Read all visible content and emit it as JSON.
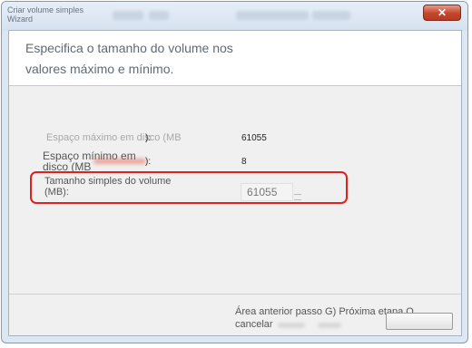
{
  "window": {
    "title": "Criar volume simples Wizard",
    "close_glyph": "✕"
  },
  "header": {
    "heading": "Especifica o tamanho do volume nos valores máximo e mínimo."
  },
  "fields": {
    "max_label": "Espaço máximo em disco (MB",
    "max_colon": "):",
    "max_value": "61055",
    "min_label": "Espaço mínimo em disco (MB",
    "min_colon": "):",
    "min_value": "8",
    "size_label": "Tamanho simples do volume (MB):",
    "size_input_value": "61055"
  },
  "footer": {
    "buttons_text": "Área anterior passo G) Próxima etapa Q cancelar"
  },
  "colors": {
    "highlight": "#e01f1f",
    "close_button": "#c4452b"
  },
  "icons": {
    "close": "close-icon",
    "spinner": "spinner-arrows-icon"
  }
}
